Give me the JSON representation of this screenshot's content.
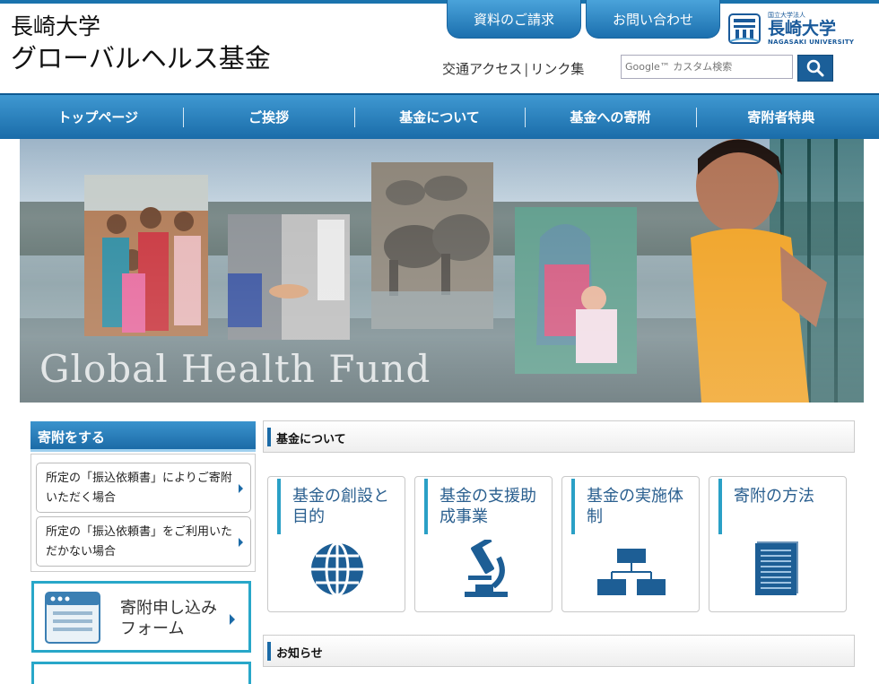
{
  "header": {
    "title_line1": "長崎大学",
    "title_line2": "グローバルヘルス基金",
    "buttons": {
      "request": "資料のご請求",
      "contact": "お問い合わせ"
    },
    "university": {
      "small": "国立大学法人",
      "name": "長崎大学",
      "english": "NAGASAKI UNIVERSITY"
    },
    "links": {
      "access": "交通アクセス",
      "separator": "|",
      "linklist": "リンク集"
    },
    "search": {
      "placeholder": "Google™ カスタム検索"
    }
  },
  "nav": {
    "items": [
      {
        "label": "トップページ"
      },
      {
        "label": "ご挨拶"
      },
      {
        "label": "基金について"
      },
      {
        "label": "基金への寄附"
      },
      {
        "label": "寄附者特典"
      }
    ]
  },
  "hero": {
    "title": "Global Health Fund"
  },
  "sidebar": {
    "heading": "寄附をする",
    "links": [
      {
        "label": "所定の「振込依頼書」によりご寄附いただく場合"
      },
      {
        "label": "所定の「振込依頼書」をご利用いただかない場合"
      }
    ],
    "form_banner": {
      "line1": "寄附申し込み",
      "line2": "フォーム"
    }
  },
  "main": {
    "section1": "基金について",
    "cards": [
      {
        "title": "基金の創設と目的",
        "icon": "globe-icon"
      },
      {
        "title": "基金の支援助成事業",
        "icon": "microscope-icon"
      },
      {
        "title": "基金の実施体制",
        "icon": "org-chart-icon"
      },
      {
        "title": "寄附の方法",
        "icon": "document-icon"
      }
    ],
    "section2": "お知らせ"
  },
  "colors": {
    "primary": "#1c6ba7",
    "accent": "#28a7c9",
    "icon": "#1d5e95"
  }
}
